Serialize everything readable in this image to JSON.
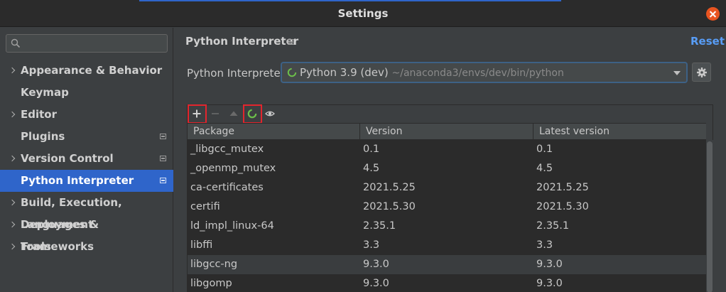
{
  "window": {
    "title": "Settings"
  },
  "sidebar": {
    "search": {
      "placeholder": "",
      "value": ""
    },
    "items": [
      {
        "label": "Appearance & Behavior",
        "expandable": true,
        "badge": false,
        "selected": false
      },
      {
        "label": "Keymap",
        "expandable": false,
        "badge": false,
        "selected": false
      },
      {
        "label": "Editor",
        "expandable": true,
        "badge": false,
        "selected": false
      },
      {
        "label": "Plugins",
        "expandable": false,
        "badge": true,
        "selected": false
      },
      {
        "label": "Version Control",
        "expandable": true,
        "badge": true,
        "selected": false
      },
      {
        "label": "Python Interpreter",
        "expandable": false,
        "badge": true,
        "selected": true
      },
      {
        "label": "Build, Execution, Deployment",
        "expandable": true,
        "badge": false,
        "selected": false
      },
      {
        "label": "Languages & Frameworks",
        "expandable": true,
        "badge": false,
        "selected": false
      },
      {
        "label": "Tools",
        "expandable": true,
        "badge": false,
        "selected": false
      }
    ]
  },
  "main": {
    "title": "Python Interpreter",
    "reset_label": "Reset",
    "interpreter": {
      "label": "Python Interpreter:",
      "name": "Python 3.9 (dev)",
      "path": "~/anaconda3/envs/dev/bin/python"
    },
    "toolbar": [
      "plus-icon",
      "minus-icon",
      "arrow-up-icon",
      "spinner-icon",
      "eye-icon"
    ],
    "table": {
      "headers": [
        "Package",
        "Version",
        "Latest version"
      ],
      "rows": [
        [
          "_libgcc_mutex",
          "0.1",
          "0.1"
        ],
        [
          "_openmp_mutex",
          "4.5",
          "4.5"
        ],
        [
          "ca-certificates",
          "2021.5.25",
          "2021.5.25"
        ],
        [
          "certifi",
          "2021.5.30",
          "2021.5.30"
        ],
        [
          "ld_impl_linux-64",
          "2.35.1",
          "2.35.1"
        ],
        [
          "libffi",
          "3.3",
          "3.3"
        ],
        [
          "libgcc-ng",
          "9.3.0",
          "9.3.0"
        ],
        [
          "libgomp",
          "9.3.0",
          "9.3.0"
        ]
      ],
      "hovered_row": 6
    }
  },
  "colors": {
    "accent": "#2f65ca",
    "link": "#589df6",
    "close": "#e95420",
    "highlight": "#e2252d",
    "spinner": "#6cbf4a"
  }
}
